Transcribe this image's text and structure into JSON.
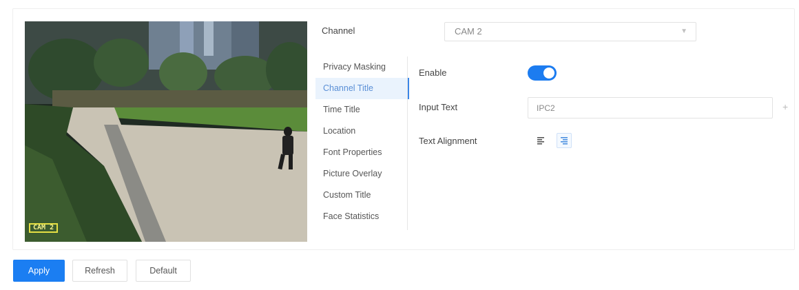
{
  "preview": {
    "osd_channel_title": "CAM 2"
  },
  "channel": {
    "label": "Channel",
    "selected": "CAM 2"
  },
  "menu": {
    "items": [
      {
        "label": "Privacy Masking"
      },
      {
        "label": "Channel Title"
      },
      {
        "label": "Time Title"
      },
      {
        "label": "Location"
      },
      {
        "label": "Font Properties"
      },
      {
        "label": "Picture Overlay"
      },
      {
        "label": "Custom Title"
      },
      {
        "label": "Face Statistics"
      }
    ],
    "active_index": 1
  },
  "form": {
    "enable_label": "Enable",
    "enable_on": true,
    "input_text_label": "Input Text",
    "input_text_value": "IPC2",
    "text_alignment_label": "Text Alignment",
    "text_alignment_selected": "right"
  },
  "buttons": {
    "apply": "Apply",
    "refresh": "Refresh",
    "default": "Default"
  },
  "colors": {
    "primary": "#1b7ef2",
    "osd_border": "#e6e043"
  },
  "icons": {
    "channel_dropdown": "chevron-down-icon",
    "add": "plus-icon",
    "align_left": "align-left-icon",
    "align_right": "align-right-icon"
  }
}
